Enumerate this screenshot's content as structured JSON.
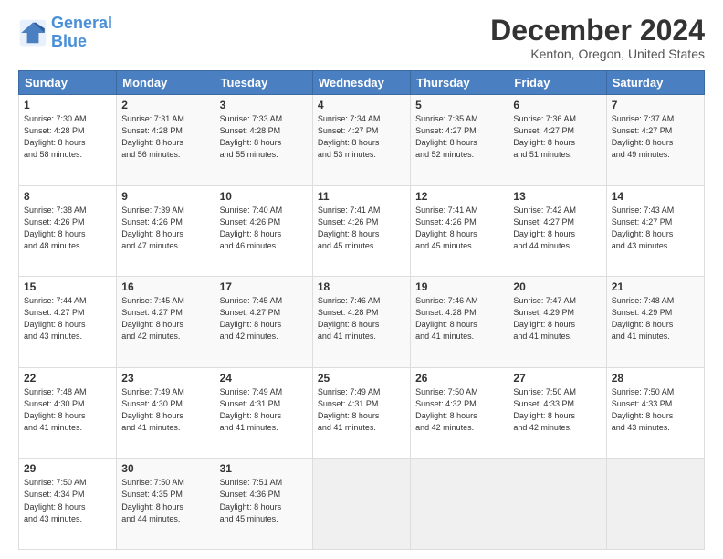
{
  "logo": {
    "line1": "General",
    "line2": "Blue"
  },
  "title": "December 2024",
  "subtitle": "Kenton, Oregon, United States",
  "days_header": [
    "Sunday",
    "Monday",
    "Tuesday",
    "Wednesday",
    "Thursday",
    "Friday",
    "Saturday"
  ],
  "weeks": [
    [
      {
        "day": "1",
        "sunrise": "7:30 AM",
        "sunset": "4:28 PM",
        "daylight": "8 hours and 58 minutes."
      },
      {
        "day": "2",
        "sunrise": "7:31 AM",
        "sunset": "4:28 PM",
        "daylight": "8 hours and 56 minutes."
      },
      {
        "day": "3",
        "sunrise": "7:33 AM",
        "sunset": "4:28 PM",
        "daylight": "8 hours and 55 minutes."
      },
      {
        "day": "4",
        "sunrise": "7:34 AM",
        "sunset": "4:27 PM",
        "daylight": "8 hours and 53 minutes."
      },
      {
        "day": "5",
        "sunrise": "7:35 AM",
        "sunset": "4:27 PM",
        "daylight": "8 hours and 52 minutes."
      },
      {
        "day": "6",
        "sunrise": "7:36 AM",
        "sunset": "4:27 PM",
        "daylight": "8 hours and 51 minutes."
      },
      {
        "day": "7",
        "sunrise": "7:37 AM",
        "sunset": "4:27 PM",
        "daylight": "8 hours and 49 minutes."
      }
    ],
    [
      {
        "day": "8",
        "sunrise": "7:38 AM",
        "sunset": "4:26 PM",
        "daylight": "8 hours and 48 minutes."
      },
      {
        "day": "9",
        "sunrise": "7:39 AM",
        "sunset": "4:26 PM",
        "daylight": "8 hours and 47 minutes."
      },
      {
        "day": "10",
        "sunrise": "7:40 AM",
        "sunset": "4:26 PM",
        "daylight": "8 hours and 46 minutes."
      },
      {
        "day": "11",
        "sunrise": "7:41 AM",
        "sunset": "4:26 PM",
        "daylight": "8 hours and 45 minutes."
      },
      {
        "day": "12",
        "sunrise": "7:41 AM",
        "sunset": "4:26 PM",
        "daylight": "8 hours and 45 minutes."
      },
      {
        "day": "13",
        "sunrise": "7:42 AM",
        "sunset": "4:27 PM",
        "daylight": "8 hours and 44 minutes."
      },
      {
        "day": "14",
        "sunrise": "7:43 AM",
        "sunset": "4:27 PM",
        "daylight": "8 hours and 43 minutes."
      }
    ],
    [
      {
        "day": "15",
        "sunrise": "7:44 AM",
        "sunset": "4:27 PM",
        "daylight": "8 hours and 43 minutes."
      },
      {
        "day": "16",
        "sunrise": "7:45 AM",
        "sunset": "4:27 PM",
        "daylight": "8 hours and 42 minutes."
      },
      {
        "day": "17",
        "sunrise": "7:45 AM",
        "sunset": "4:27 PM",
        "daylight": "8 hours and 42 minutes."
      },
      {
        "day": "18",
        "sunrise": "7:46 AM",
        "sunset": "4:28 PM",
        "daylight": "8 hours and 41 minutes."
      },
      {
        "day": "19",
        "sunrise": "7:46 AM",
        "sunset": "4:28 PM",
        "daylight": "8 hours and 41 minutes."
      },
      {
        "day": "20",
        "sunrise": "7:47 AM",
        "sunset": "4:29 PM",
        "daylight": "8 hours and 41 minutes."
      },
      {
        "day": "21",
        "sunrise": "7:48 AM",
        "sunset": "4:29 PM",
        "daylight": "8 hours and 41 minutes."
      }
    ],
    [
      {
        "day": "22",
        "sunrise": "7:48 AM",
        "sunset": "4:30 PM",
        "daylight": "8 hours and 41 minutes."
      },
      {
        "day": "23",
        "sunrise": "7:49 AM",
        "sunset": "4:30 PM",
        "daylight": "8 hours and 41 minutes."
      },
      {
        "day": "24",
        "sunrise": "7:49 AM",
        "sunset": "4:31 PM",
        "daylight": "8 hours and 41 minutes."
      },
      {
        "day": "25",
        "sunrise": "7:49 AM",
        "sunset": "4:31 PM",
        "daylight": "8 hours and 41 minutes."
      },
      {
        "day": "26",
        "sunrise": "7:50 AM",
        "sunset": "4:32 PM",
        "daylight": "8 hours and 42 minutes."
      },
      {
        "day": "27",
        "sunrise": "7:50 AM",
        "sunset": "4:33 PM",
        "daylight": "8 hours and 42 minutes."
      },
      {
        "day": "28",
        "sunrise": "7:50 AM",
        "sunset": "4:33 PM",
        "daylight": "8 hours and 43 minutes."
      }
    ],
    [
      {
        "day": "29",
        "sunrise": "7:50 AM",
        "sunset": "4:34 PM",
        "daylight": "8 hours and 43 minutes."
      },
      {
        "day": "30",
        "sunrise": "7:50 AM",
        "sunset": "4:35 PM",
        "daylight": "8 hours and 44 minutes."
      },
      {
        "day": "31",
        "sunrise": "7:51 AM",
        "sunset": "4:36 PM",
        "daylight": "8 hours and 45 minutes."
      },
      null,
      null,
      null,
      null
    ]
  ]
}
